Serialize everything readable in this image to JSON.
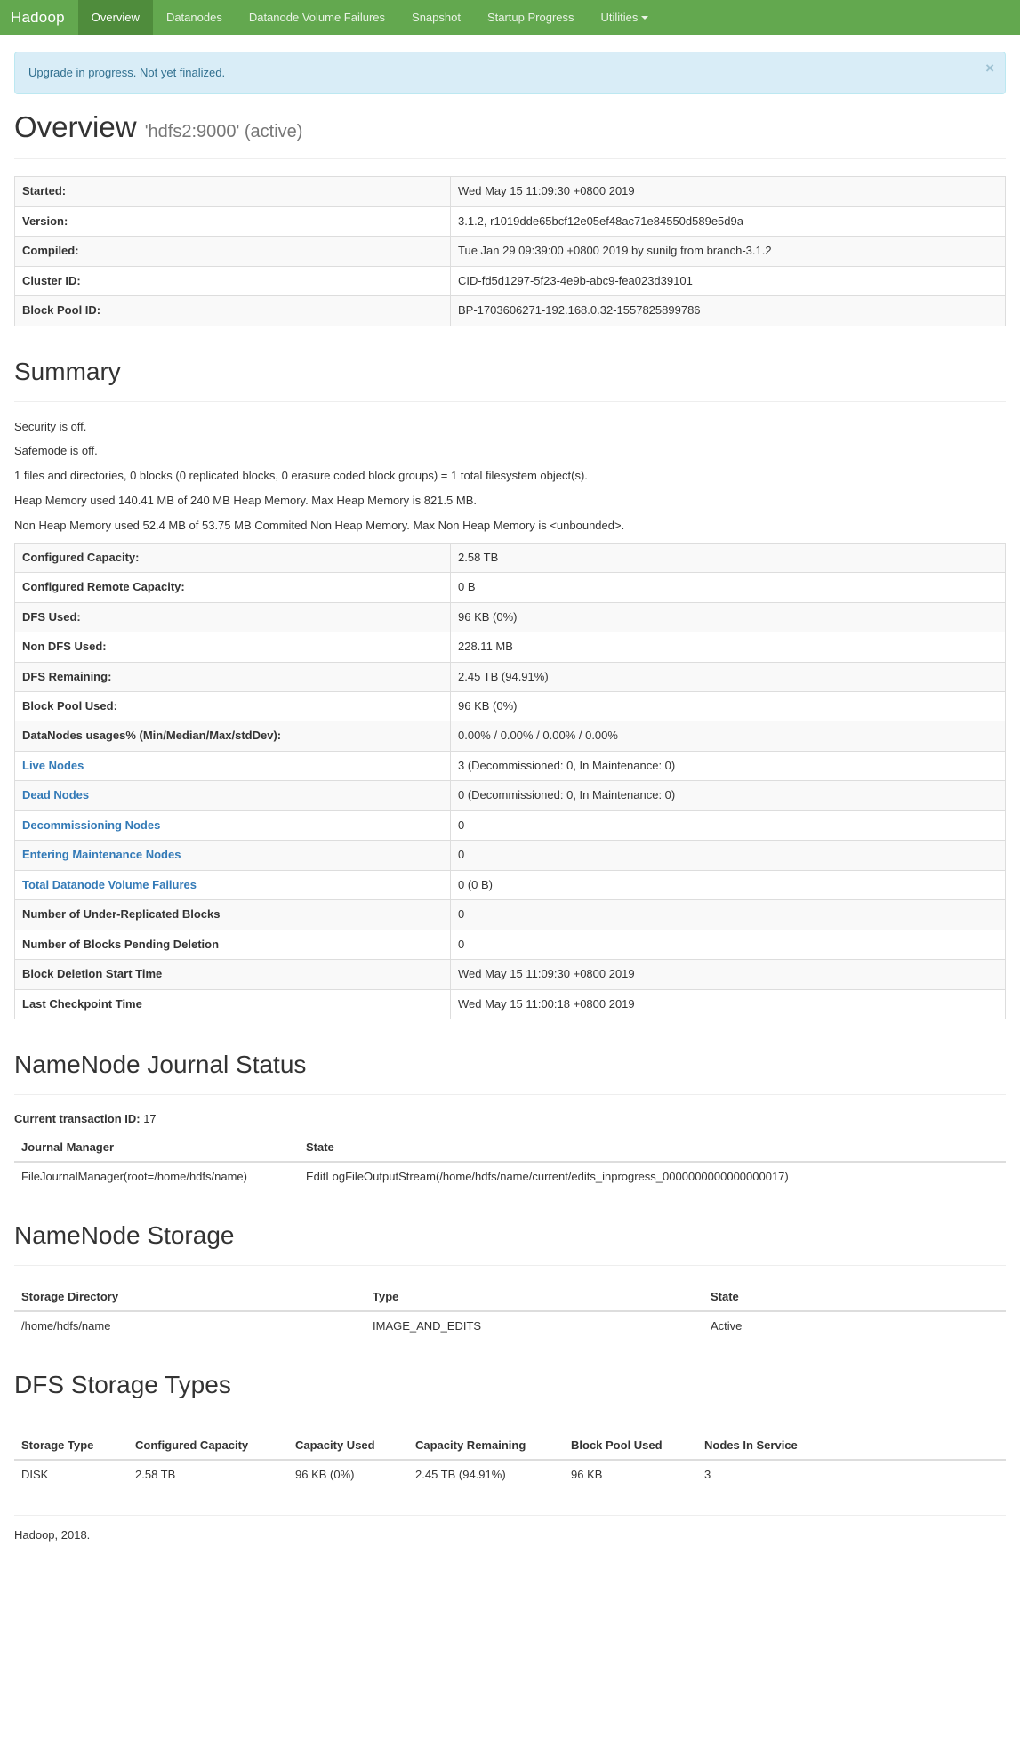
{
  "navbar": {
    "brand": "Hadoop",
    "items": [
      {
        "label": "Overview",
        "active": true
      },
      {
        "label": "Datanodes",
        "active": false
      },
      {
        "label": "Datanode Volume Failures",
        "active": false
      },
      {
        "label": "Snapshot",
        "active": false
      },
      {
        "label": "Startup Progress",
        "active": false
      },
      {
        "label": "Utilities",
        "active": false,
        "dropdown": true
      }
    ]
  },
  "alert": {
    "message": "Upgrade in progress. Not yet finalized.",
    "close_label": "×"
  },
  "overview": {
    "title": "Overview",
    "subtitle": "'hdfs2:9000' (active)",
    "rows": [
      {
        "key": "Started:",
        "value": "Wed May 15 11:09:30 +0800 2019"
      },
      {
        "key": "Version:",
        "value": "3.1.2, r1019dde65bcf12e05ef48ac71e84550d589e5d9a"
      },
      {
        "key": "Compiled:",
        "value": "Tue Jan 29 09:39:00 +0800 2019 by sunilg from branch-3.1.2"
      },
      {
        "key": "Cluster ID:",
        "value": "CID-fd5d1297-5f23-4e9b-abc9-fea023d39101"
      },
      {
        "key": "Block Pool ID:",
        "value": "BP-1703606271-192.168.0.32-1557825899786"
      }
    ]
  },
  "summary": {
    "title": "Summary",
    "paragraphs": [
      "Security is off.",
      "Safemode is off.",
      "1 files and directories, 0 blocks (0 replicated blocks, 0 erasure coded block groups) = 1 total filesystem object(s).",
      "Heap Memory used 140.41 MB of 240 MB Heap Memory. Max Heap Memory is 821.5 MB.",
      "Non Heap Memory used 52.4 MB of 53.75 MB Commited Non Heap Memory. Max Non Heap Memory is <unbounded>."
    ],
    "rows": [
      {
        "key": "Configured Capacity:",
        "value": "2.58 TB",
        "link": false
      },
      {
        "key": "Configured Remote Capacity:",
        "value": "0 B",
        "link": false
      },
      {
        "key": "DFS Used:",
        "value": "96 KB (0%)",
        "link": false
      },
      {
        "key": "Non DFS Used:",
        "value": "228.11 MB",
        "link": false
      },
      {
        "key": "DFS Remaining:",
        "value": "2.45 TB (94.91%)",
        "link": false
      },
      {
        "key": "Block Pool Used:",
        "value": "96 KB (0%)",
        "link": false
      },
      {
        "key": "DataNodes usages% (Min/Median/Max/stdDev):",
        "value": "0.00% / 0.00% / 0.00% / 0.00%",
        "link": false
      },
      {
        "key": "Live Nodes",
        "value": "3 (Decommissioned: 0, In Maintenance: 0)",
        "link": true
      },
      {
        "key": "Dead Nodes",
        "value": "0 (Decommissioned: 0, In Maintenance: 0)",
        "link": true
      },
      {
        "key": "Decommissioning Nodes",
        "value": "0",
        "link": true
      },
      {
        "key": "Entering Maintenance Nodes",
        "value": "0",
        "link": true
      },
      {
        "key": "Total Datanode Volume Failures",
        "value": "0 (0 B)",
        "link": true
      },
      {
        "key": "Number of Under-Replicated Blocks",
        "value": "0",
        "link": false
      },
      {
        "key": "Number of Blocks Pending Deletion",
        "value": "0",
        "link": false
      },
      {
        "key": "Block Deletion Start Time",
        "value": "Wed May 15 11:09:30 +0800 2019",
        "link": false
      },
      {
        "key": "Last Checkpoint Time",
        "value": "Wed May 15 11:00:18 +0800 2019",
        "link": false
      }
    ]
  },
  "journal": {
    "title": "NameNode Journal Status",
    "current_tx_label": "Current transaction ID:",
    "current_tx_value": "17",
    "columns": [
      "Journal Manager",
      "State"
    ],
    "rows": [
      {
        "manager": "FileJournalManager(root=/home/hdfs/name)",
        "state": "EditLogFileOutputStream(/home/hdfs/name/current/edits_inprogress_0000000000000000017)"
      }
    ]
  },
  "storage": {
    "title": "NameNode Storage",
    "columns": [
      "Storage Directory",
      "Type",
      "State"
    ],
    "rows": [
      {
        "dir": "/home/hdfs/name",
        "type": "IMAGE_AND_EDITS",
        "state": "Active"
      }
    ]
  },
  "storage_types": {
    "title": "DFS Storage Types",
    "columns": [
      "Storage Type",
      "Configured Capacity",
      "Capacity Used",
      "Capacity Remaining",
      "Block Pool Used",
      "Nodes In Service"
    ],
    "rows": [
      {
        "type": "DISK",
        "configured_capacity": "2.58 TB",
        "capacity_used": "96 KB (0%)",
        "capacity_remaining": "2.45 TB (94.91%)",
        "block_pool_used": "96 KB",
        "nodes_in_service": "3"
      }
    ]
  },
  "footer": {
    "text": "Hadoop, 2018."
  },
  "colors": {
    "navbar_green": "#63a84f",
    "navbar_active": "#4f8c3c",
    "link_blue": "#337ab7",
    "alert_bg": "#d9edf7",
    "alert_border": "#bce8f1",
    "alert_text": "#31708f"
  }
}
